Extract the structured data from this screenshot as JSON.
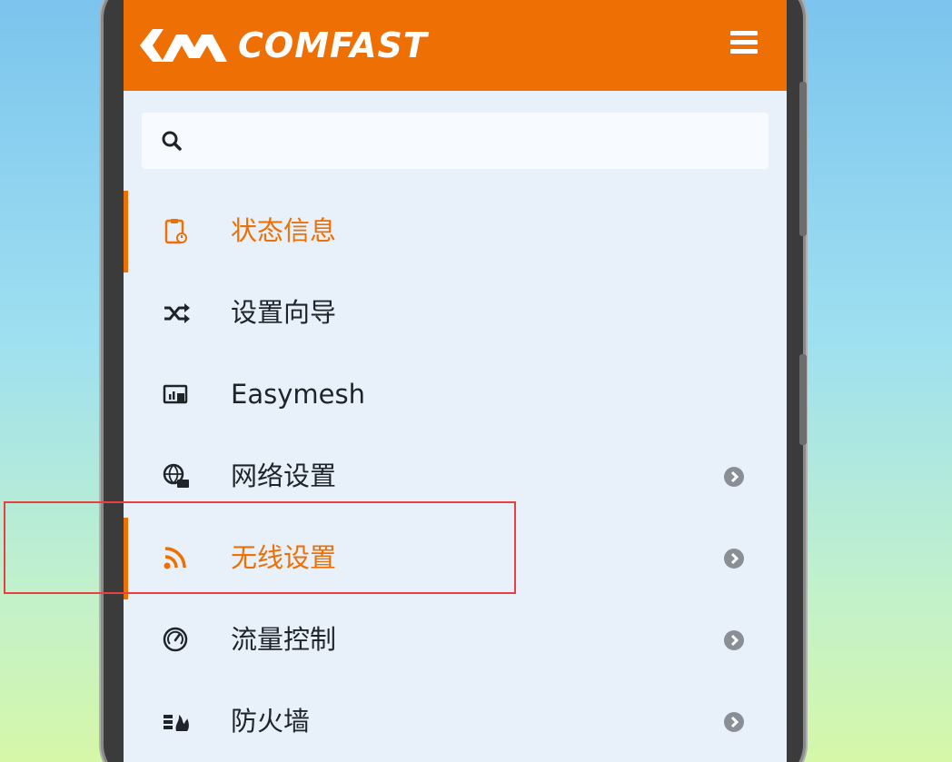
{
  "header": {
    "brand": "COMFAST",
    "menu_icon": "hamburger-menu-icon"
  },
  "search": {
    "placeholder": "",
    "value": "",
    "icon": "search-icon"
  },
  "nav": {
    "items": [
      {
        "label": "状态信息",
        "icon": "clipboard-status-icon",
        "active": true,
        "has_arrow": false
      },
      {
        "label": "设置向导",
        "icon": "shuffle-icon",
        "active": false,
        "has_arrow": false
      },
      {
        "label": "Easymesh",
        "icon": "mesh-monitor-icon",
        "active": false,
        "has_arrow": false
      },
      {
        "label": "网络设置",
        "icon": "globe-network-icon",
        "active": false,
        "has_arrow": true
      },
      {
        "label": "无线设置",
        "icon": "wifi-rss-icon",
        "active": true,
        "has_arrow": true
      },
      {
        "label": "流量控制",
        "icon": "gauge-icon",
        "active": false,
        "has_arrow": true
      },
      {
        "label": "防火墙",
        "icon": "firewall-icon",
        "active": false,
        "has_arrow": true
      }
    ]
  },
  "colors": {
    "brand_orange": "#ee7004",
    "highlight_red": "#e84040",
    "menu_background": "#e8f1fa"
  }
}
